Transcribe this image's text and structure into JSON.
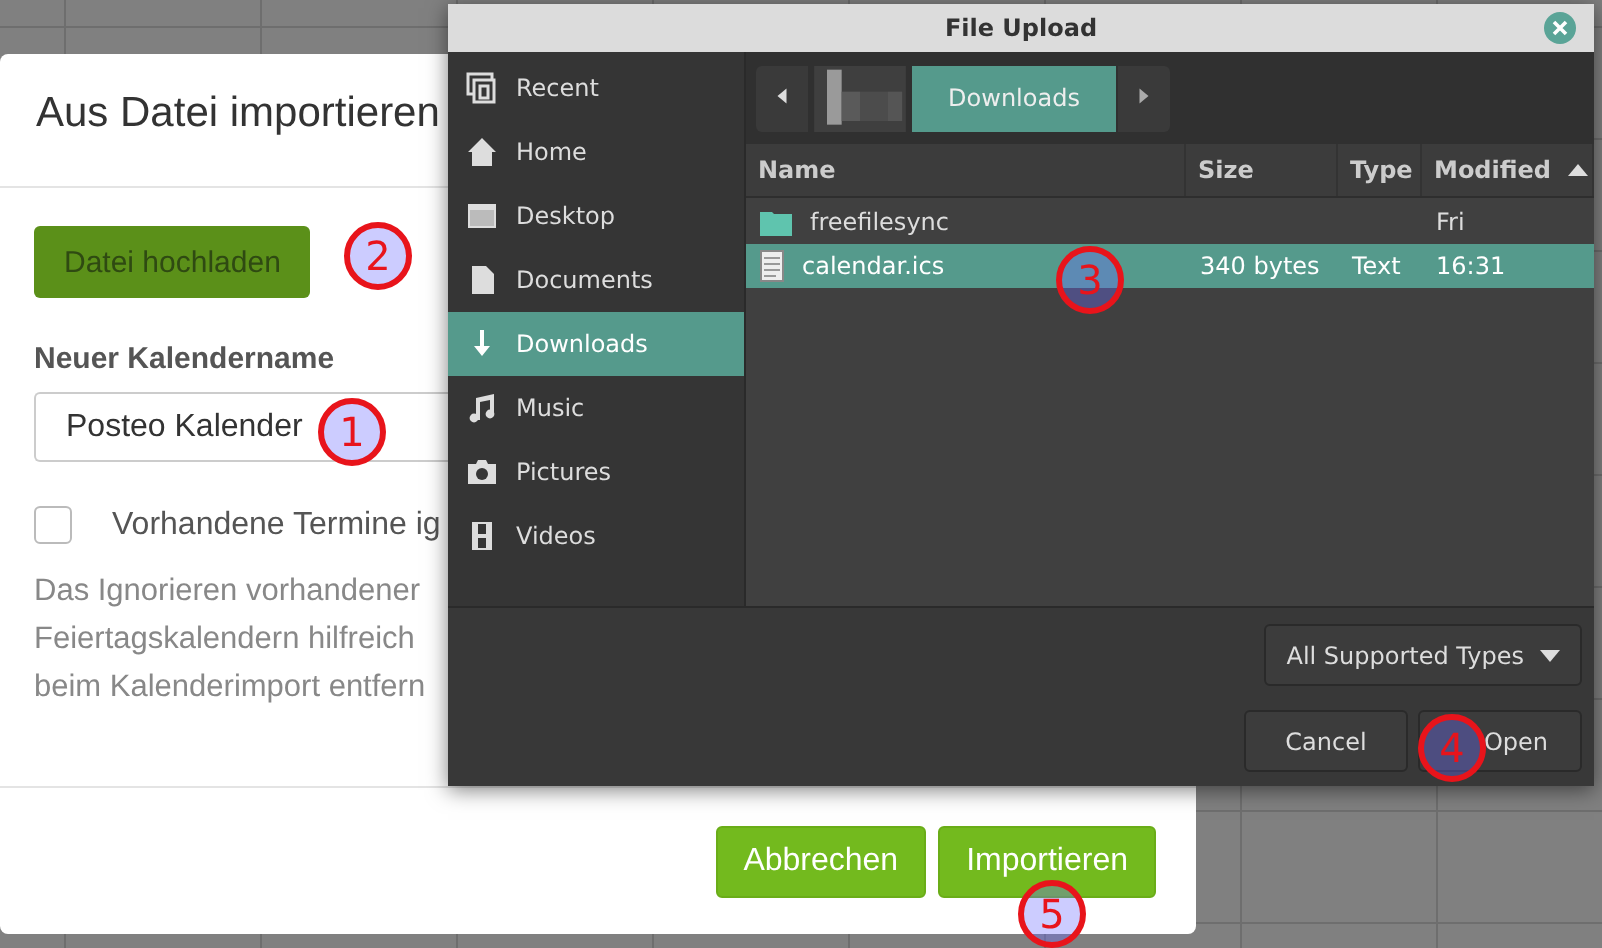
{
  "import_dialog": {
    "title": "Aus Datei importieren",
    "upload_button": "Datei hochladen",
    "name_label": "Neuer Kalendername",
    "name_value": "Posteo Kalender",
    "ignore_checkbox": {
      "label": "Vorhandene Termine ig",
      "checked": false
    },
    "help_lines": [
      "Das Ignorieren vorhandener",
      "Feiertagskalendern hilfreich",
      "beim Kalenderimport entfern"
    ],
    "buttons": [
      "Abbrechen",
      "Importieren"
    ]
  },
  "file_dialog": {
    "title": "File Upload",
    "places": [
      {
        "label": "Recent",
        "kind": "recent",
        "selected": false
      },
      {
        "label": "Home",
        "kind": "home",
        "selected": false
      },
      {
        "label": "Desktop",
        "kind": "desktop",
        "selected": false
      },
      {
        "label": "Documents",
        "kind": "documents",
        "selected": false
      },
      {
        "label": "Downloads",
        "kind": "downloads",
        "selected": true
      },
      {
        "label": "Music",
        "kind": "music",
        "selected": false
      },
      {
        "label": "Pictures",
        "kind": "pictures",
        "selected": false
      },
      {
        "label": "Videos",
        "kind": "videos",
        "selected": false
      }
    ],
    "path": [
      "Downloads"
    ],
    "columns": [
      "Name",
      "Size",
      "Type",
      "Modified"
    ],
    "rows": [
      {
        "kind": "folder",
        "name": "freefilesync",
        "size": "",
        "type": "",
        "modified": "Fri",
        "selected": false
      },
      {
        "kind": "file",
        "name": "calendar.ics",
        "size": "340 bytes",
        "type": "Text",
        "modified": "16:31",
        "selected": true
      }
    ],
    "filter": "All Supported Types",
    "buttons": [
      "Cancel",
      "Open"
    ]
  },
  "annotations": [
    "1",
    "2",
    "3",
    "4",
    "5"
  ]
}
